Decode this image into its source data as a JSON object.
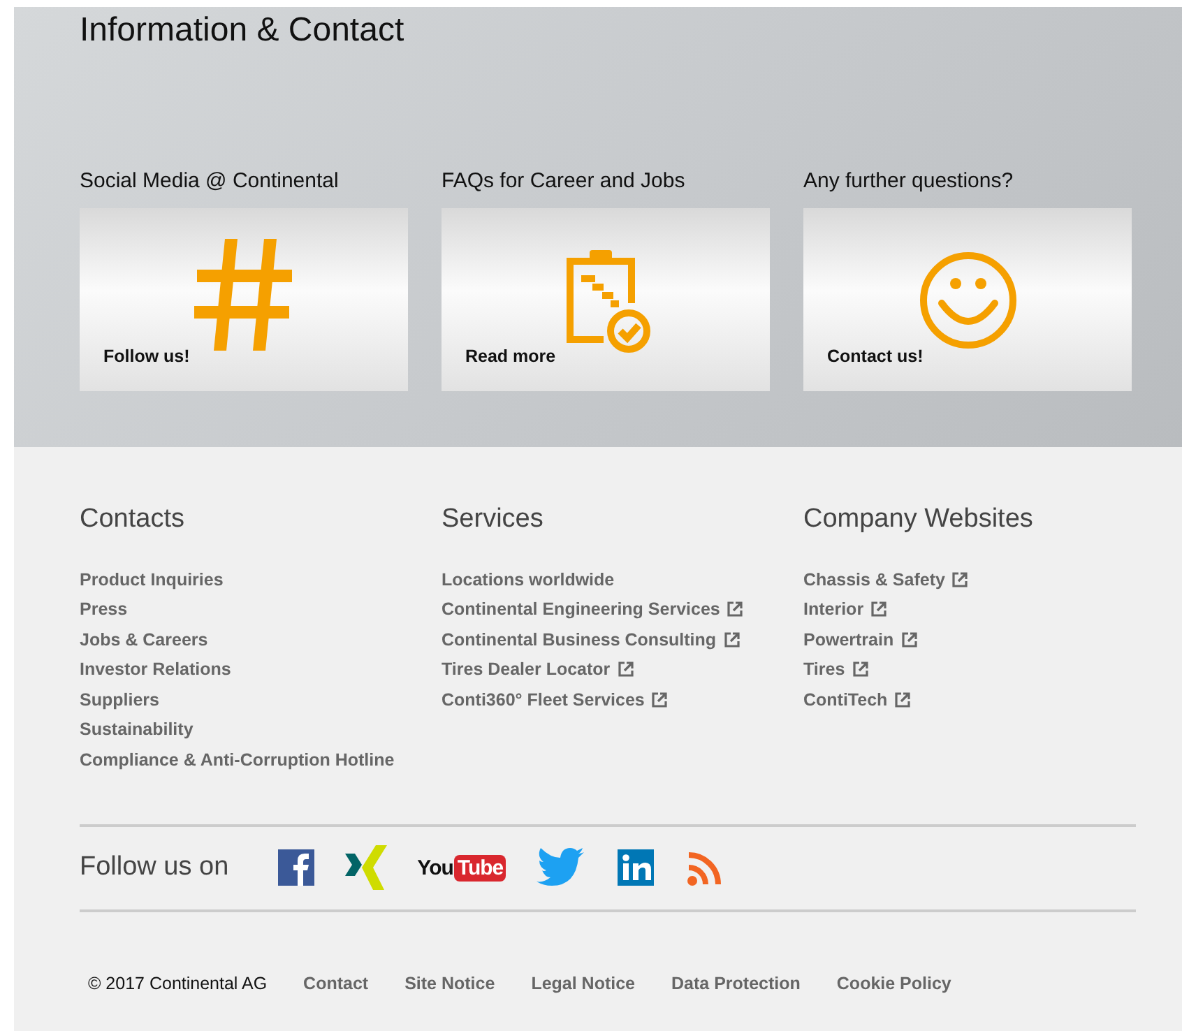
{
  "header": {
    "title": "Information & Contact"
  },
  "teasers": [
    {
      "kind": "hashtag",
      "title": "Social Media @ Continental",
      "link": "Follow us!"
    },
    {
      "kind": "clipboard",
      "title": "FAQs for Career and Jobs",
      "link": "Read more"
    },
    {
      "kind": "smiley",
      "title": "Any further questions?",
      "link": "Contact us!"
    }
  ],
  "link_columns": [
    {
      "title": "Contacts",
      "links": [
        {
          "label": "Product Inquiries",
          "external": false
        },
        {
          "label": "Press",
          "external": false
        },
        {
          "label": "Jobs & Careers",
          "external": false
        },
        {
          "label": "Investor Relations",
          "external": false
        },
        {
          "label": "Suppliers",
          "external": false
        },
        {
          "label": "Sustainability",
          "external": false
        },
        {
          "label": "Compliance & Anti-Corruption Hotline",
          "external": false
        }
      ]
    },
    {
      "title": "Services",
      "links": [
        {
          "label": "Locations worldwide",
          "external": false
        },
        {
          "label": "Continental Engineering Services",
          "external": true
        },
        {
          "label": "Continental Business Consulting",
          "external": true
        },
        {
          "label": "Tires Dealer Locator",
          "external": true
        },
        {
          "label": "Conti360° Fleet Services",
          "external": true
        }
      ]
    },
    {
      "title": "Company Websites",
      "links": [
        {
          "label": "Chassis & Safety",
          "external": true
        },
        {
          "label": "Interior",
          "external": true
        },
        {
          "label": "Powertrain",
          "external": true
        },
        {
          "label": "Tires",
          "external": true
        },
        {
          "label": "ContiTech",
          "external": true
        }
      ]
    }
  ],
  "social": {
    "label": "Follow us on",
    "icons": [
      {
        "kind": "facebook"
      },
      {
        "kind": "xing"
      },
      {
        "kind": "youtube",
        "text_parts": [
          "You",
          "Tube"
        ]
      },
      {
        "kind": "twitter"
      },
      {
        "kind": "linkedin"
      },
      {
        "kind": "rss"
      }
    ]
  },
  "footer": {
    "copyright": "© 2017 Continental AG",
    "links": [
      "Contact",
      "Site Notice",
      "Legal Notice",
      "Data Protection",
      "Cookie Policy"
    ]
  }
}
